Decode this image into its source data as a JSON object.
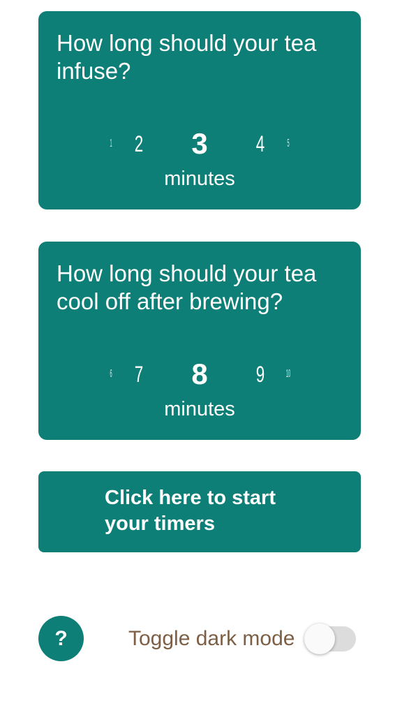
{
  "infuse_card": {
    "question": "How long should your tea infuse?",
    "picker": {
      "far_left": "1",
      "near_left": "2",
      "selected": "3",
      "near_right": "4",
      "far_right": "5"
    },
    "unit": "minutes"
  },
  "cool_card": {
    "question": "How long should your tea cool off after brewing?",
    "picker": {
      "far_left": "6",
      "near_left": "7",
      "selected": "8",
      "near_right": "9",
      "far_right": "10"
    },
    "unit": "minutes"
  },
  "start_button": {
    "label": "Click here to start your timers"
  },
  "help_button": {
    "label": "?"
  },
  "dark_mode": {
    "label": "Toggle dark mode",
    "enabled": false
  },
  "colors": {
    "accent": "#0d7f77",
    "label_brown": "#7d5f45",
    "background": "#ffffff"
  }
}
